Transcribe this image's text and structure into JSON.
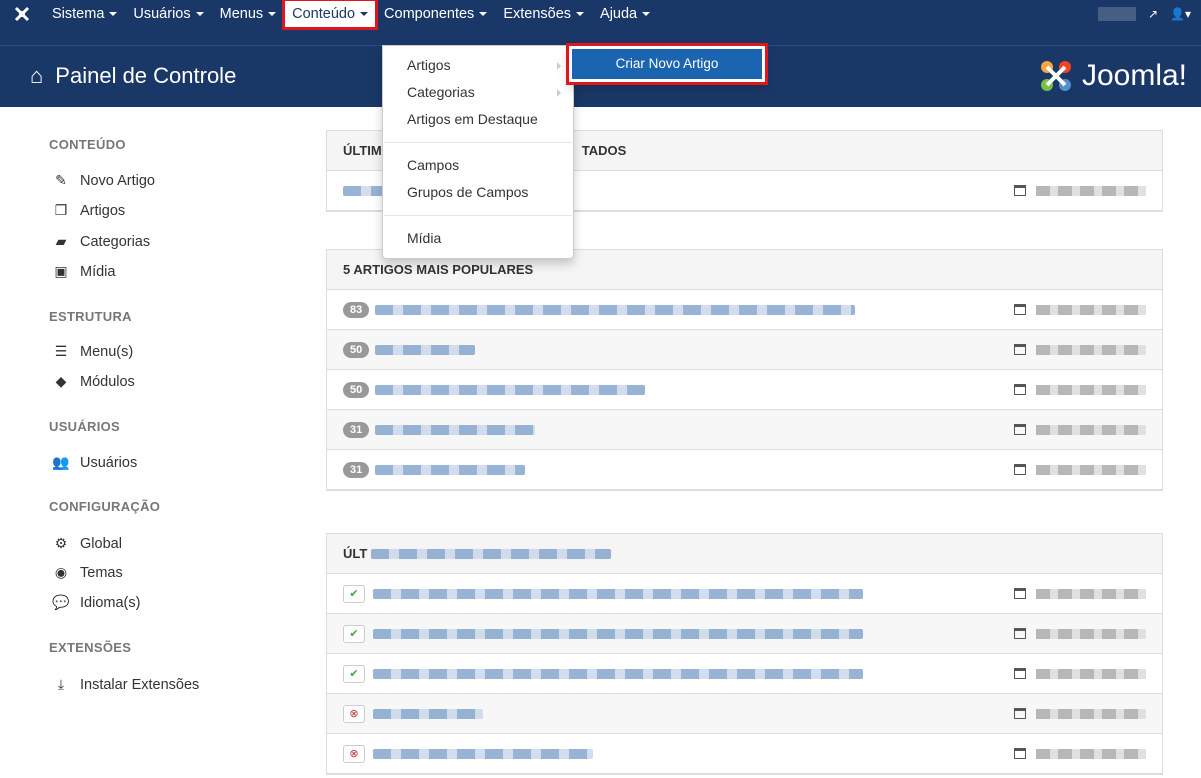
{
  "nav": {
    "items": [
      {
        "label": "Sistema"
      },
      {
        "label": "Usuários"
      },
      {
        "label": "Menus"
      },
      {
        "label": "Conteúdo"
      },
      {
        "label": "Componentes"
      },
      {
        "label": "Extensões"
      },
      {
        "label": "Ajuda"
      }
    ]
  },
  "header": {
    "title": "Painel de Controle",
    "brand": "Joomla!"
  },
  "sidebar": {
    "sections": [
      {
        "title": "CONTEÚDO",
        "items": [
          {
            "label": "Novo Artigo"
          },
          {
            "label": "Artigos"
          },
          {
            "label": "Categorias"
          },
          {
            "label": "Mídia"
          }
        ]
      },
      {
        "title": "ESTRUTURA",
        "items": [
          {
            "label": "Menu(s)"
          },
          {
            "label": "Módulos"
          }
        ]
      },
      {
        "title": "USUÁRIOS",
        "items": [
          {
            "label": "Usuários"
          }
        ]
      },
      {
        "title": "CONFIGURAÇÃO",
        "items": [
          {
            "label": "Global"
          },
          {
            "label": "Temas"
          },
          {
            "label": "Idioma(s)"
          }
        ]
      },
      {
        "title": "EXTENSÕES",
        "items": [
          {
            "label": "Instalar Extensões"
          }
        ]
      }
    ]
  },
  "panels": {
    "p1": {
      "title": "ÚLTIM",
      "title_tail": "TADOS"
    },
    "p2": {
      "title": "5 ARTIGOS MAIS POPULARES",
      "badges": [
        "83",
        "50",
        "50",
        "31",
        "31"
      ]
    },
    "p3": {
      "title": "ÚLT"
    }
  },
  "dropdown": {
    "items": [
      "Artigos",
      "Categorias",
      "Artigos em Destaque",
      "Campos",
      "Grupos de Campos",
      "Mídia"
    ],
    "submenu": "Criar Novo Artigo"
  }
}
